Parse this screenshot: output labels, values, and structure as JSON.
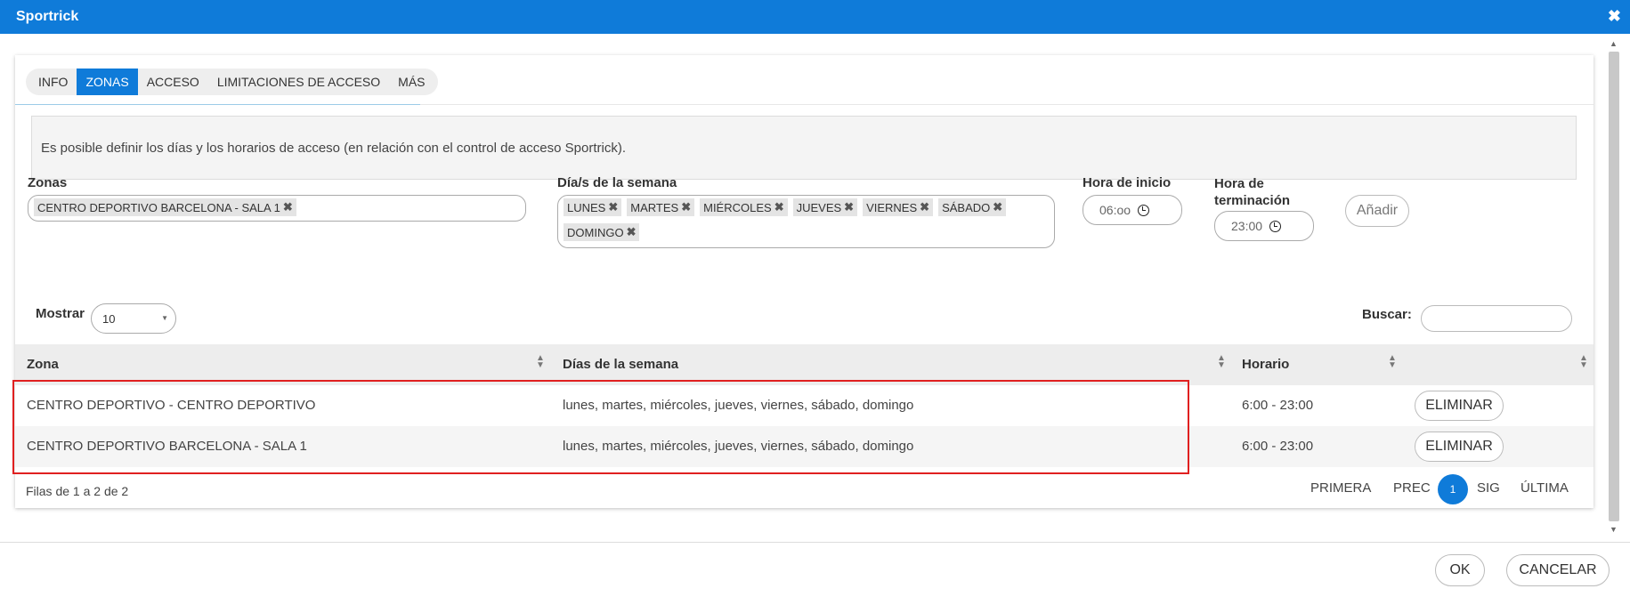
{
  "window": {
    "title": "Sportrick",
    "close_icon": "close-icon"
  },
  "tabs": [
    {
      "label": "INFO",
      "active": false
    },
    {
      "label": "ZONAS",
      "active": true
    },
    {
      "label": "ACCESO",
      "active": false
    },
    {
      "label": "LIMITACIONES DE ACCESO",
      "active": false
    },
    {
      "label": "MÁS",
      "active": false
    }
  ],
  "info_text": "Es posible definir los días y los horarios de acceso (en relación con el control de acceso Sportrick).",
  "form": {
    "zonas_label": "Zonas",
    "zonas_selected": [
      "CENTRO DEPORTIVO BARCELONA - SALA 1"
    ],
    "dias_label": "Día/s de la semana",
    "dias_selected": [
      "LUNES",
      "MARTES",
      "MIÉRCOLES",
      "JUEVES",
      "VIERNES",
      "SÁBADO",
      "DOMINGO"
    ],
    "hora_inicio_label": "Hora de inicio",
    "hora_inicio_value": "06:oo",
    "hora_fin_label": "Hora de terminación",
    "hora_fin_value": "23:00",
    "add_button": "Añadir"
  },
  "table_controls": {
    "mostrar_label": "Mostrar",
    "mostrar_value": "10",
    "buscar_label": "Buscar:",
    "buscar_value": ""
  },
  "table": {
    "columns": [
      "Zona",
      "Días de la semana",
      "Horario",
      ""
    ],
    "rows": [
      {
        "zona": "CENTRO DEPORTIVO - CENTRO DEPORTIVO",
        "dias": "lunes, martes, miércoles, jueves, viernes, sábado, domingo",
        "horario": "6:00 - 23:00",
        "action": "ELIMINAR"
      },
      {
        "zona": "CENTRO DEPORTIVO BARCELONA - SALA 1",
        "dias": "lunes, martes, miércoles, jueves, viernes, sábado, domingo",
        "horario": "6:00 - 23:00",
        "action": "ELIMINAR"
      }
    ],
    "info": "Filas de 1 a 2 de 2"
  },
  "pagination": {
    "first": "PRIMERA",
    "prev": "PREC",
    "current": "1",
    "next": "SIG",
    "last": "ÚLTIMA"
  },
  "dialog_buttons": {
    "ok": "OK",
    "cancel": "CANCELAR"
  },
  "colors": {
    "primary": "#0f7bd9",
    "highlight": "#e02020"
  }
}
